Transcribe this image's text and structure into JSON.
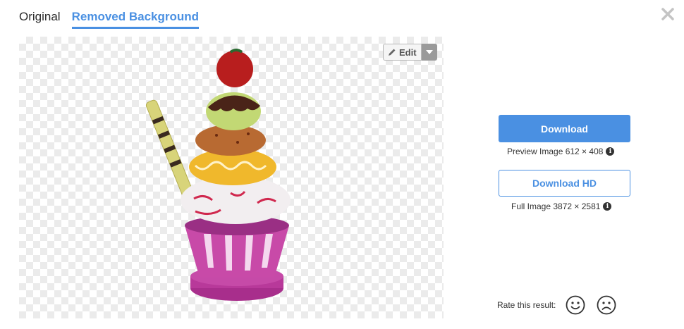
{
  "tabs": {
    "original": "Original",
    "removed_background": "Removed Background",
    "active": "removed_background"
  },
  "preview": {
    "edit_label": "Edit"
  },
  "download": {
    "label": "Download",
    "info": "Preview Image 612 × 408"
  },
  "download_hd": {
    "label": "Download HD",
    "info": "Full Image 3872 × 2581"
  },
  "rating": {
    "label": "Rate this result:"
  },
  "colors": {
    "accent": "#4a90e2",
    "checker": "#ebebeb"
  },
  "icons": [
    "close-icon",
    "pencil-icon",
    "caret-down-icon",
    "info-icon",
    "smile-icon",
    "frown-icon"
  ]
}
